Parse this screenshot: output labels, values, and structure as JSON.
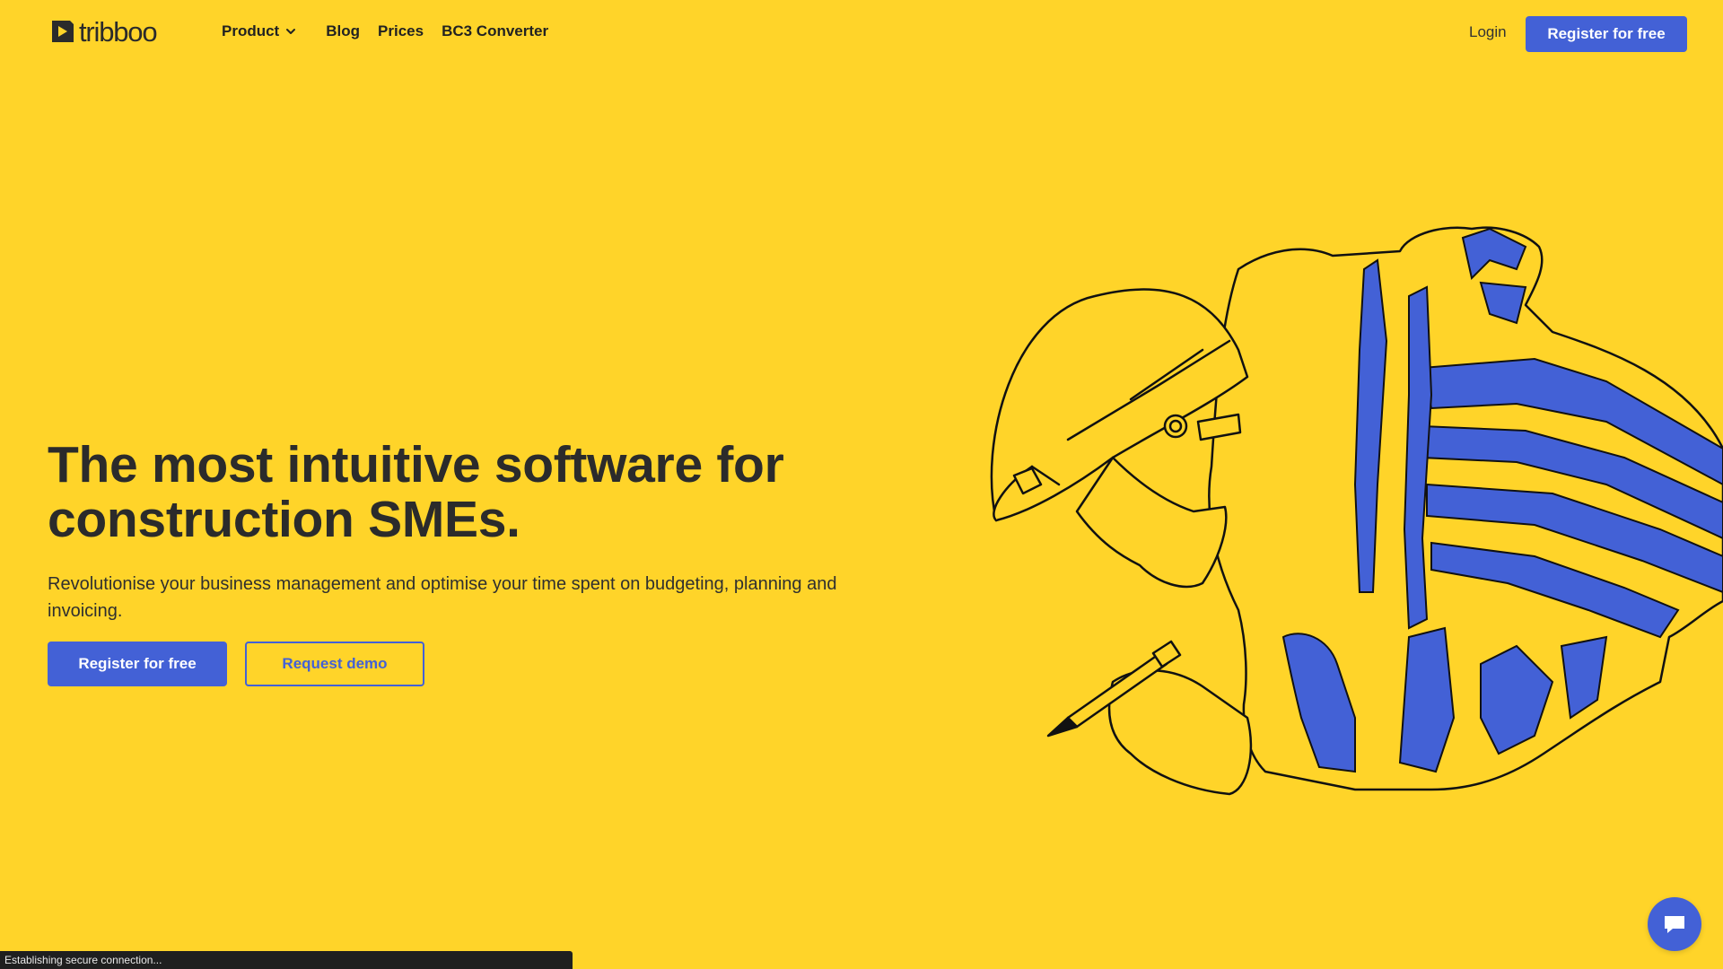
{
  "brand": {
    "name": "tribboo"
  },
  "nav": {
    "items": [
      {
        "label": "Product",
        "has_dropdown": true
      },
      {
        "label": "Blog"
      },
      {
        "label": "Prices"
      },
      {
        "label": "BC3 Converter"
      }
    ],
    "login_label": "Login",
    "register_label": "Register for free"
  },
  "hero": {
    "title": "The most intuitive software for construction SMEs.",
    "subtitle": "Revolutionise your business management and optimise your time spent on budgeting, planning and invoicing.",
    "primary_cta": "Register for free",
    "secondary_cta": "Request demo"
  },
  "status": {
    "text": "Establishing secure connection..."
  },
  "colors": {
    "background": "#FFD429",
    "accent": "#4361D6",
    "text": "#2b2b2b"
  },
  "icons": {
    "logo": "tribboo-logo-icon",
    "dropdown": "chevron-down-icon",
    "chat": "chat-bubble-icon"
  }
}
